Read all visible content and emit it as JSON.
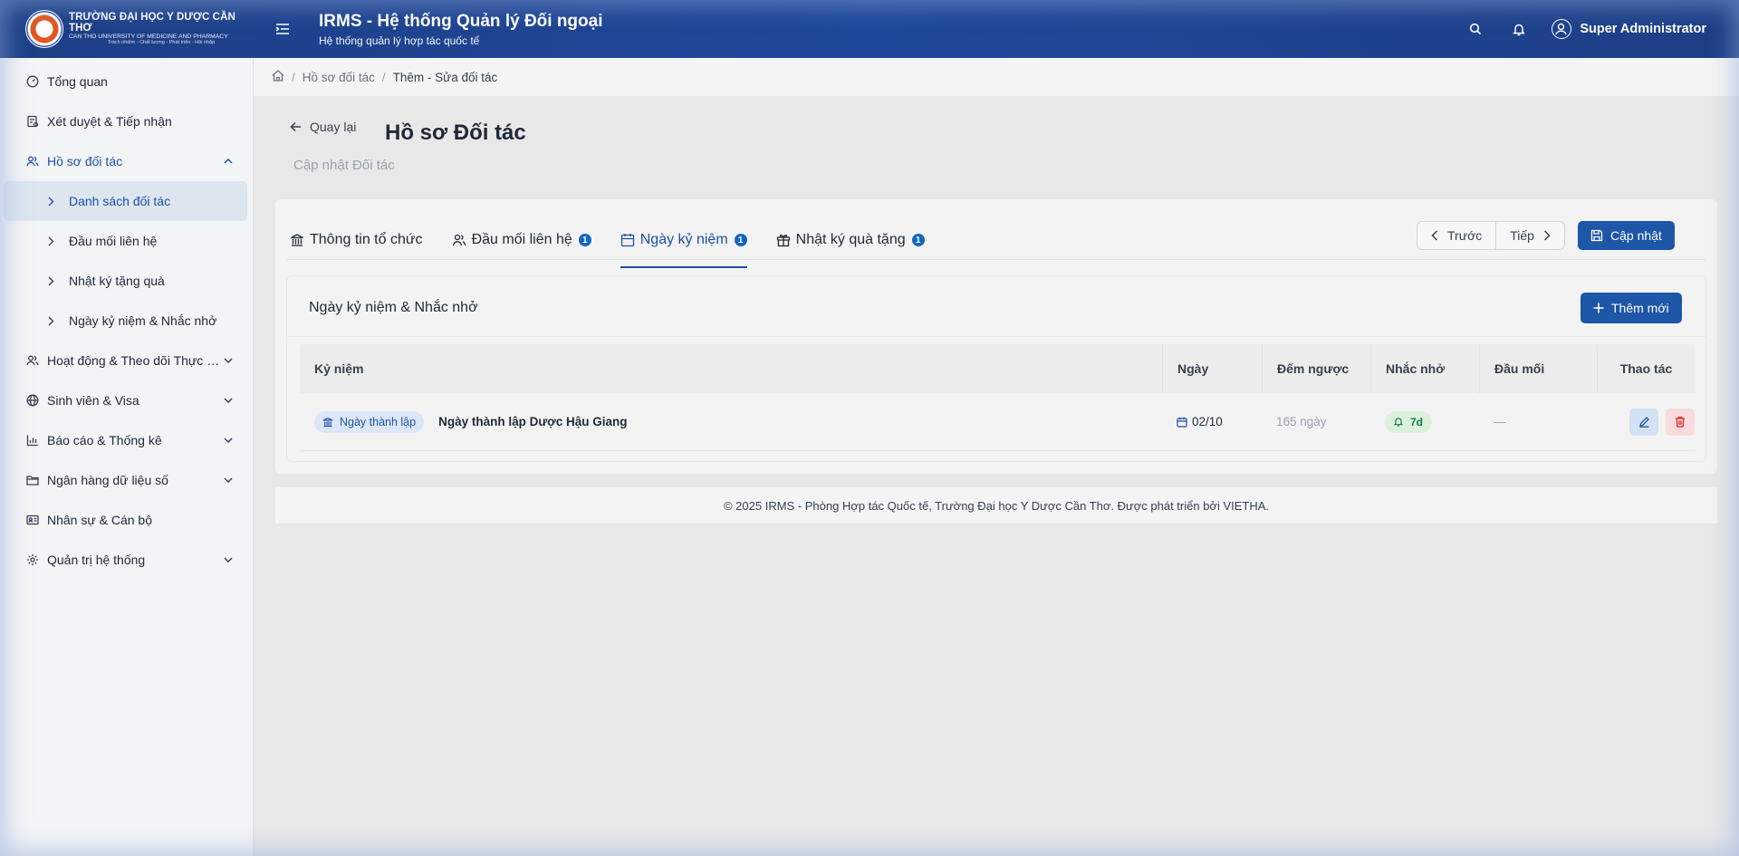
{
  "header": {
    "logo": {
      "line1": "TRƯỜNG ĐẠI HỌC Y DƯỢC CẦN THƠ",
      "line2": "CAN THO UNIVERSITY OF MEDICINE AND PHARMACY",
      "line3": "Trách nhiệm - Chất lượng - Phát triển - Hội nhập"
    },
    "title": "IRMS - Hệ thống Quản lý Đối ngoại",
    "subtitle": "Hệ thống quản lý hợp tác quốc tế",
    "user_name": "Super Administrator",
    "icons": [
      "menu-icon",
      "search-icon",
      "bell-icon",
      "user-circle-icon"
    ]
  },
  "sidebar": {
    "items": [
      {
        "label": "Tổng quan",
        "icon": "dashboard-icon"
      },
      {
        "label": "Xét duyệt & Tiếp nhận",
        "icon": "clipboard-icon"
      },
      {
        "label": "Hồ sơ đối tác",
        "icon": "users-icon",
        "expanded": true,
        "children": [
          {
            "label": "Danh sách đối tác",
            "active": true
          },
          {
            "label": "Đầu mối liên hệ"
          },
          {
            "label": "Nhật ký tặng quà"
          },
          {
            "label": "Ngày kỷ niệm & Nhắc nhở"
          }
        ]
      },
      {
        "label": "Hoạt động & Theo dõi Thực hiện",
        "icon": "activity-icon"
      },
      {
        "label": "Sinh viên & Visa",
        "icon": "globe-icon"
      },
      {
        "label": "Báo cáo & Thống kê",
        "icon": "bar-chart-icon"
      },
      {
        "label": "Ngân hàng dữ liệu số",
        "icon": "folder-icon"
      },
      {
        "label": "Nhân sự & Cán bộ",
        "icon": "id-card-icon"
      },
      {
        "label": "Quản trị hệ thống",
        "icon": "gear-icon"
      }
    ]
  },
  "breadcrumb": {
    "items": [
      "Hồ sơ đối tác",
      "Thêm - Sửa đối tác"
    ]
  },
  "page": {
    "back_label": "Quay lại",
    "title": "Hồ sơ Đối tác",
    "subtitle": "Cập nhật Đối tác"
  },
  "tabs": [
    {
      "label": "Thông tin tổ chức",
      "icon": "bank-icon",
      "badge": ""
    },
    {
      "label": "Đầu mối liên hệ",
      "icon": "users-icon",
      "badge": "1"
    },
    {
      "label": "Ngày kỷ niệm",
      "icon": "calendar-icon",
      "badge": "1",
      "active": true
    },
    {
      "label": "Nhật ký quà tặng",
      "icon": "gift-icon",
      "badge": "1"
    }
  ],
  "pager": {
    "prev_label": "Trước",
    "next_label": "Tiếp"
  },
  "update_label": "Cập nhật",
  "section": {
    "title": "Ngày kỷ niệm & Nhắc nhở",
    "add_label": "Thêm mới"
  },
  "table": {
    "headers": [
      "Kỷ niệm",
      "Ngày",
      "Đếm ngược",
      "Nhắc nhở",
      "Đầu mối",
      "Thao tác"
    ],
    "rows": [
      {
        "tag": "Ngày thành lập",
        "name": "Ngày thành lập Dược Hậu Giang",
        "date": "02/10",
        "countdown": "165 ngày",
        "remind": "7d",
        "contact": "—"
      }
    ]
  },
  "footer": {
    "text": "© 2025 IRMS - Phòng Hợp tác Quốc tế, Trường Đại học Y Dược Cần Thơ. Được phát triển bởi VIETHA."
  },
  "colors": {
    "header_bg": "#1d3f86",
    "primary": "#1e56a8",
    "badge": "#1565c0",
    "remind_bg": "#dcf1dc",
    "remind_text": "#15803d",
    "delete_bg": "#fadada"
  }
}
